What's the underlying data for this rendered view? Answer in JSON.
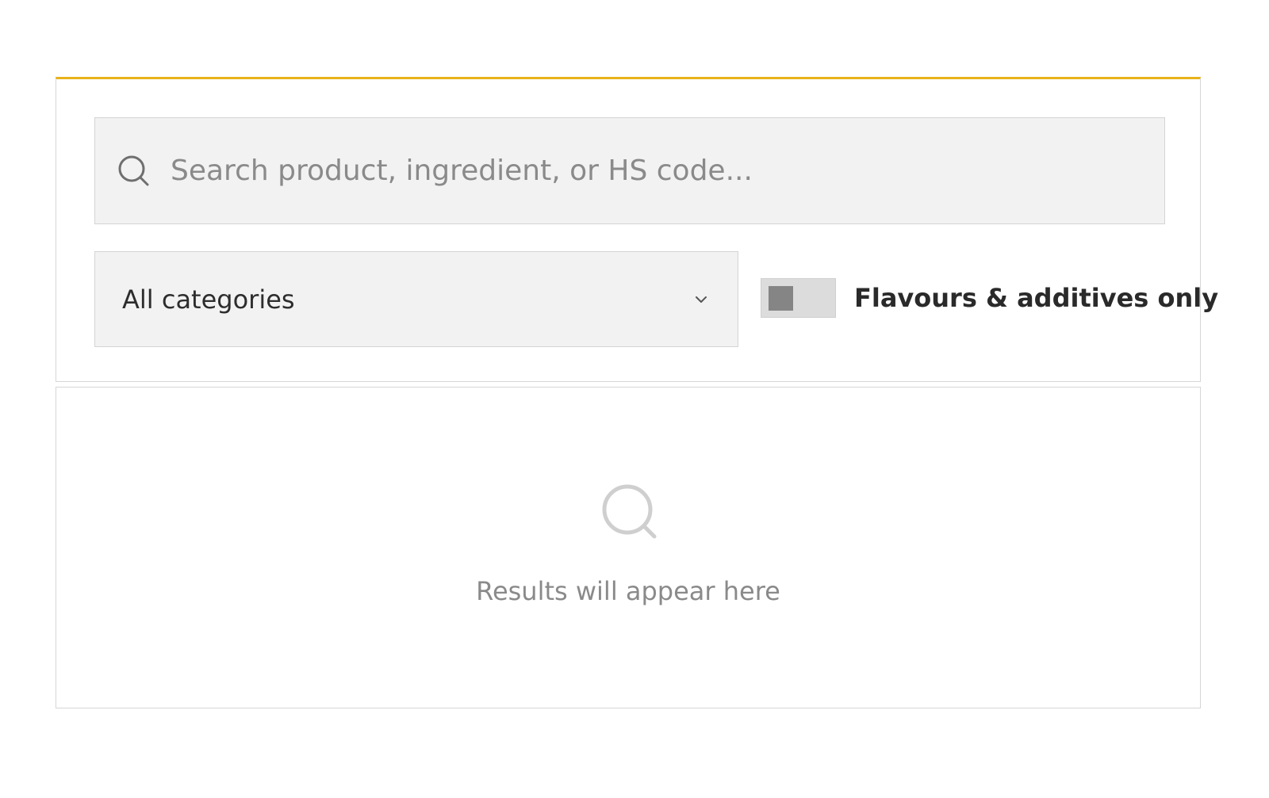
{
  "search": {
    "placeholder": "Search product, ingredient, or HS code...",
    "value": "",
    "icon": "search-icon"
  },
  "filters": {
    "category": {
      "selected": "All categories",
      "icon": "chevron-down-icon"
    },
    "toggle": {
      "label": "Flavours & additives only",
      "checked": false
    }
  },
  "results": {
    "empty_message": "Results will appear here",
    "icon": "search-icon"
  },
  "colors": {
    "accent": "#e8b219",
    "field_bg": "#f2f2f2",
    "muted_text": "#8a8a8a"
  }
}
